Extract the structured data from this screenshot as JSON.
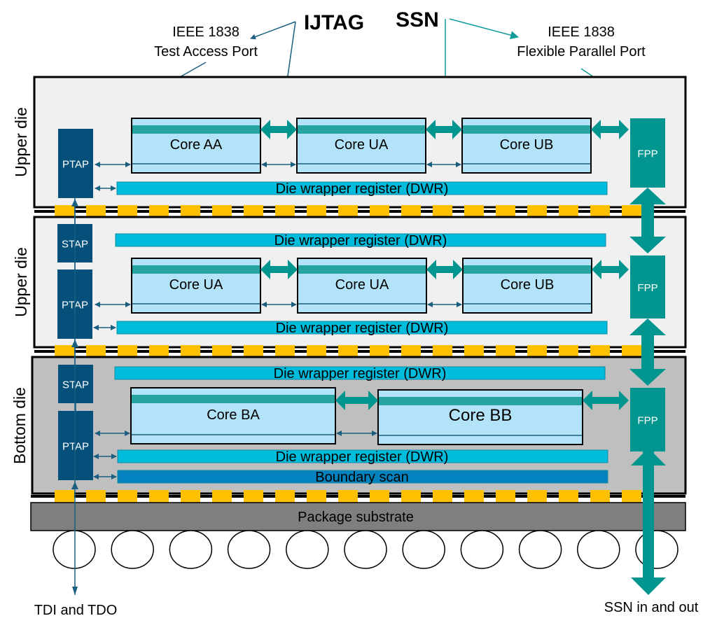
{
  "colors": {
    "die_upper_fill": "#f0f0f0",
    "die_bottom_fill": "#bfbfbf",
    "die_border": "#000000",
    "tap_fill": "#04507a",
    "fpp_fill": "#00968f",
    "core_fill": "#b3e3f8",
    "core_band": "#26a3a3",
    "dwr_fill": "#00bcdc",
    "bscan_fill": "#0283bf",
    "bump": "#ffc000",
    "substrate": "#7f7f7f",
    "ijtag_line": "#1a5f80",
    "ssn_line": "#119b9b"
  },
  "annotations": {
    "ijtag": "IJTAG",
    "ssn": "SSN",
    "tap_line1": "IEEE 1838",
    "tap_line2": "Test Access Port",
    "fpp_line1": "IEEE 1838",
    "fpp_line2": "Flexible Parallel Port",
    "tdi_tdo": "TDI and TDO",
    "ssn_io": "SSN in and out"
  },
  "dies": [
    {
      "label": "Upper die",
      "ptap": "PTAP",
      "fpp": "FPP",
      "cores": [
        "Core AA",
        "Core UA",
        "Core UB"
      ],
      "dwr_bottom": "Die wrapper register (DWR)"
    },
    {
      "label": "Upper die",
      "stap": "STAP",
      "ptap": "PTAP",
      "fpp": "FPP",
      "dwr_top": "Die wrapper register (DWR)",
      "cores": [
        "Core UA",
        "Core UA",
        "Core UB"
      ],
      "dwr_bottom": "Die wrapper register (DWR)"
    },
    {
      "label": "Bottom die",
      "stap": "STAP",
      "ptap": "PTAP",
      "fpp": "FPP",
      "dwr_top": "Die wrapper register (DWR)",
      "cores": [
        "Core BA",
        "Core BB"
      ],
      "dwr_bottom": "Die wrapper register (DWR)",
      "boundary_scan": "Boundary scan"
    }
  ],
  "package": {
    "substrate_label": "Package substrate",
    "solder_ball_count": 11
  }
}
